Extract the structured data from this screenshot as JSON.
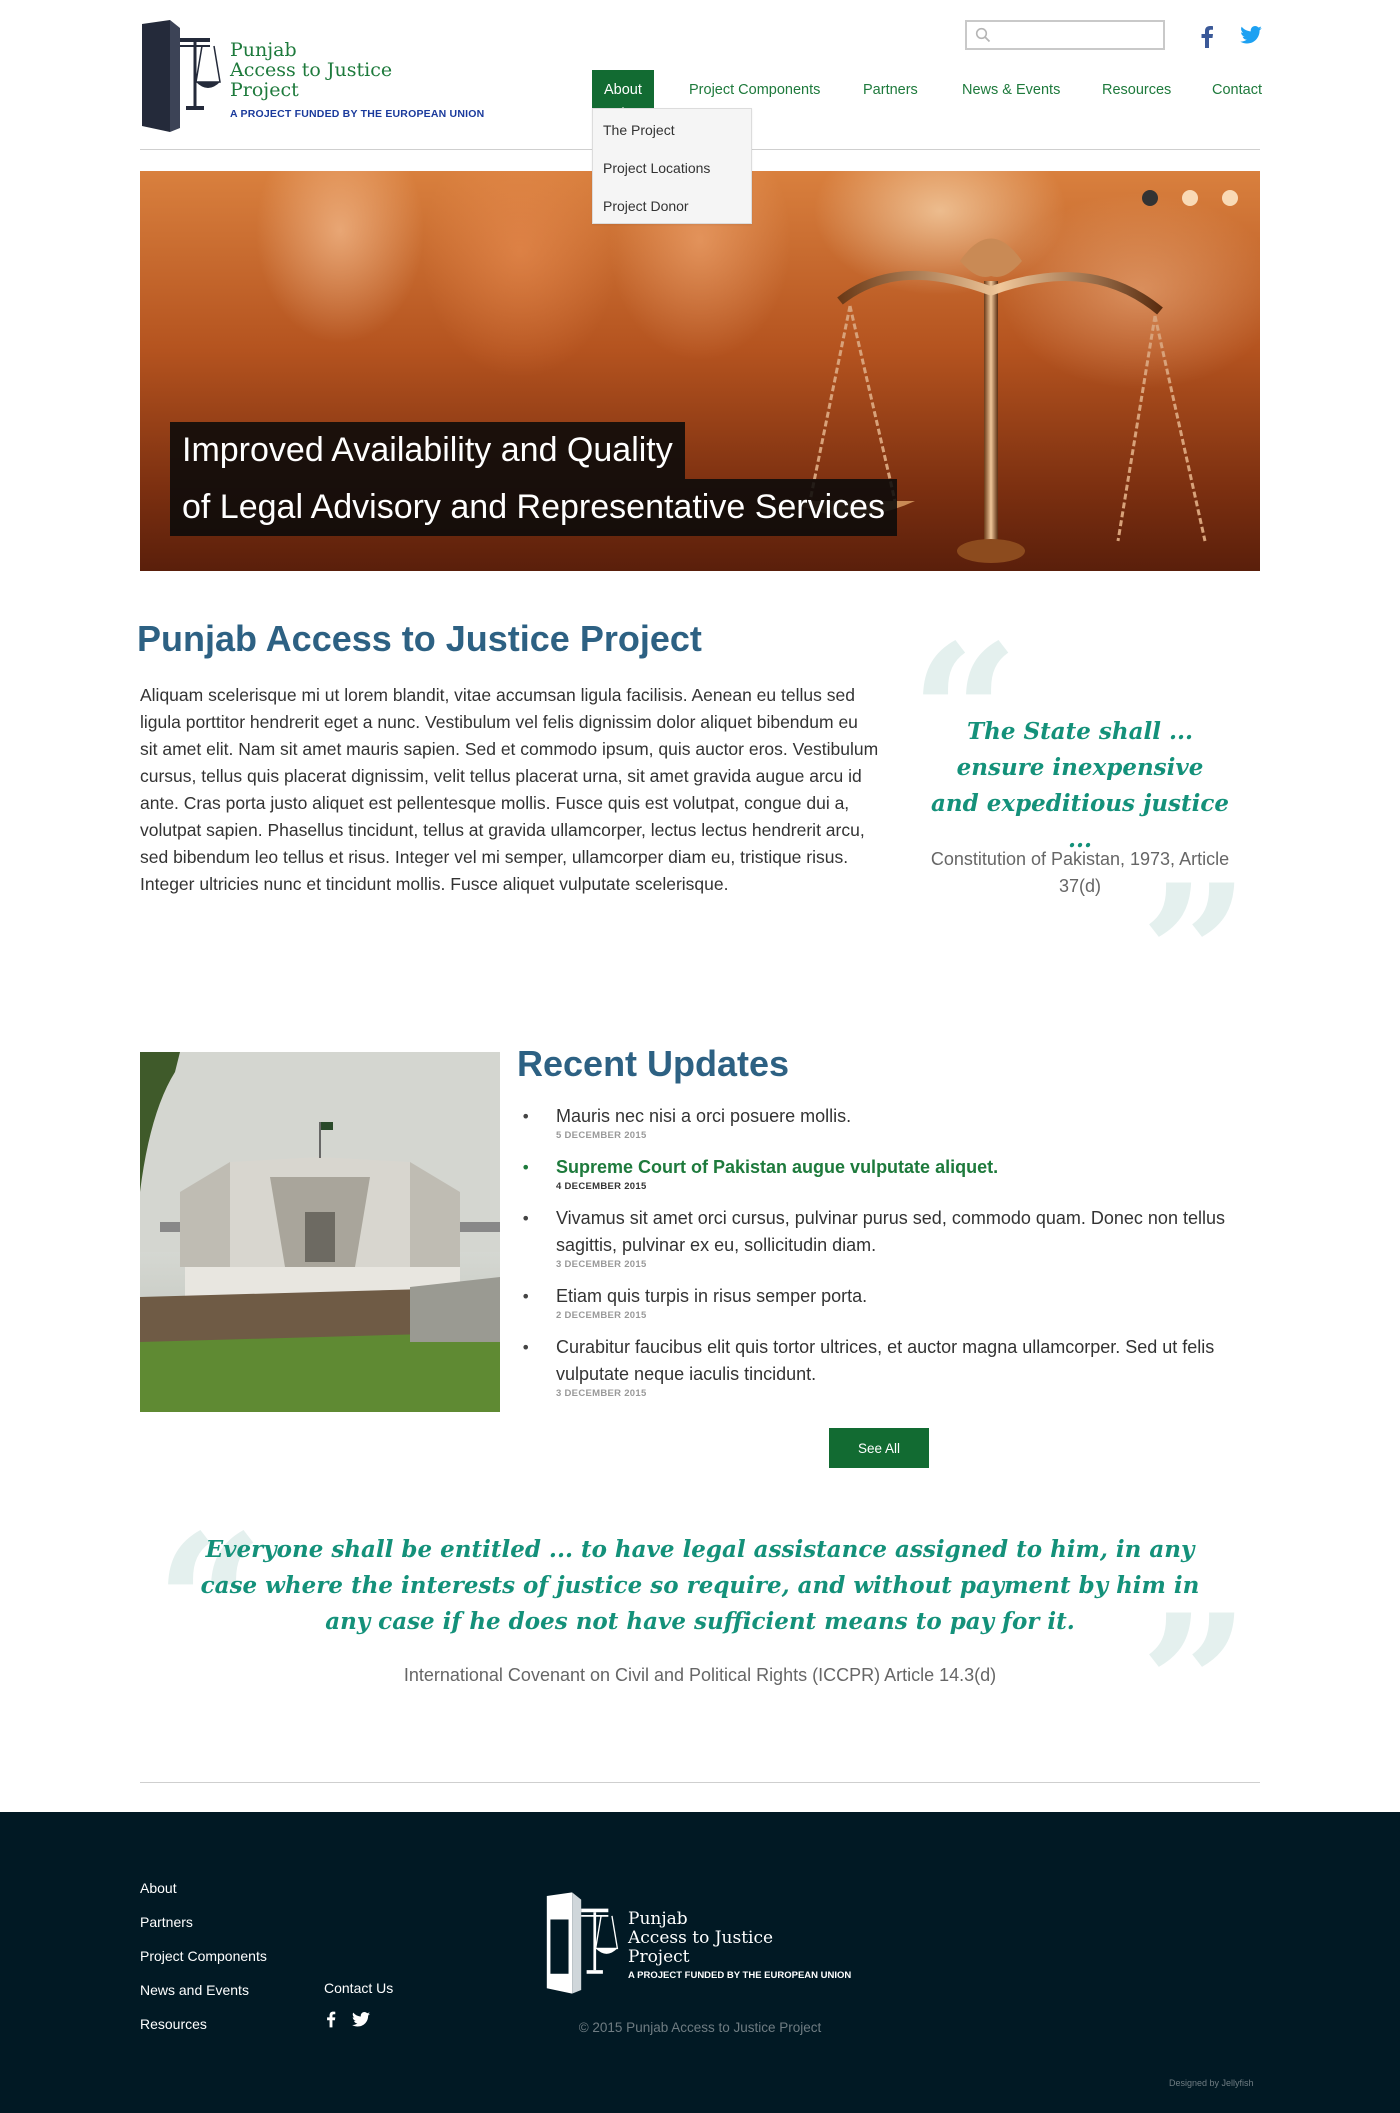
{
  "header": {
    "logo": {
      "line1": "Punjab",
      "line2": "Access to Justice",
      "line3": "Project",
      "tagline": "A PROJECT FUNDED BY THE EUROPEAN UNION"
    },
    "search": {
      "placeholder": "",
      "icon": "search-icon"
    },
    "social": [
      {
        "name": "facebook",
        "icon": "facebook-icon",
        "color": "#3b5998"
      },
      {
        "name": "twitter",
        "icon": "twitter-icon",
        "color": "#1da1f2"
      }
    ],
    "nav": [
      {
        "label": "About",
        "active": true
      },
      {
        "label": "Project Components"
      },
      {
        "label": "Partners"
      },
      {
        "label": "News & Events"
      },
      {
        "label": "Resources"
      },
      {
        "label": "Contact"
      }
    ],
    "dropdown": [
      "The Project",
      "Project Locations",
      "Project Donor"
    ]
  },
  "hero": {
    "caption_line1": "Improved Availability and Quality",
    "caption_line2": "of Legal Advisory and Representative Services",
    "slides": 3,
    "active_slide": 1
  },
  "intro": {
    "title": "Punjab Access to Justice Project",
    "body": "Aliquam scelerisque mi ut lorem blandit, vitae accumsan ligula facilisis. Aenean eu tellus sed ligula porttitor hendrerit eget a nunc. Vestibulum vel felis dignissim dolor aliquet bibendum eu sit amet elit. Nam sit amet mauris sapien. Sed et commodo ipsum, quis auctor eros. Vestibulum cursus, tellus quis placerat dignissim, velit tellus placerat urna, sit amet gravida augue arcu id ante. Cras porta justo aliquet est pellentesque mollis. Fusce quis est volutpat, congue dui a, volutpat sapien. Phasellus tincidunt, tellus at gravida ullamcorper, lectus lectus hendrerit arcu, sed bibendum leo tellus et risus. Integer vel mi semper, ullamcorper diam eu, tristique risus. Integer ultricies nunc et tincidunt mollis. Fusce aliquet vulputate scelerisque."
  },
  "quote1": {
    "text": "The State shall ... ensure inexpensive and expeditious justice ...",
    "source": "Constitution of Pakistan, 1973, Article 37(d)"
  },
  "updates": {
    "title": "Recent Updates",
    "items": [
      {
        "text": "Mauris nec nisi a orci posuere mollis.",
        "date": "5 DECEMBER 2015",
        "highlight": false
      },
      {
        "text": "Supreme Court of Pakistan augue vulputate aliquet.",
        "date": "4 DECEMBER 2015",
        "highlight": true
      },
      {
        "text": "Vivamus sit amet orci cursus, pulvinar purus sed, commodo quam. Donec non tellus sagittis, pulvinar ex eu, sollicitudin diam.",
        "date": "3 DECEMBER 2015",
        "highlight": false
      },
      {
        "text": "Etiam quis turpis in risus semper porta.",
        "date": "2 DECEMBER 2015",
        "highlight": false
      },
      {
        "text": "Curabitur faucibus elit quis tortor ultrices, et auctor magna ullamcorper. Sed ut felis vulputate neque iaculis tincidunt.",
        "date": "3 DECEMBER 2015",
        "highlight": false
      }
    ],
    "see_all": "See All"
  },
  "quote2": {
    "text": "Everyone shall be entitled ... to have legal assistance assigned to him, in any case where the interests of justice so require, and without payment by him in any case if he does not have sufficient means to pay for it.",
    "source": "International Covenant on Civil and Political Rights (ICCPR) Article 14.3(d)"
  },
  "footer": {
    "links": [
      "About",
      "Partners",
      "Project Components",
      "News and Events",
      "Resources"
    ],
    "contact": "Contact Us",
    "logo": {
      "line1": "Punjab",
      "line2": "Access to Justice",
      "line3": "Project",
      "tagline": "A PROJECT FUNDED BY THE EUROPEAN UNION"
    },
    "copyright": "© 2015 Punjab Access to Justice Project",
    "credit": "Designed by Jellyfish"
  },
  "colors": {
    "brand_green": "#126b32",
    "title_blue": "#2d6183",
    "quote_teal": "#14917a",
    "footer_bg": "#011924"
  }
}
